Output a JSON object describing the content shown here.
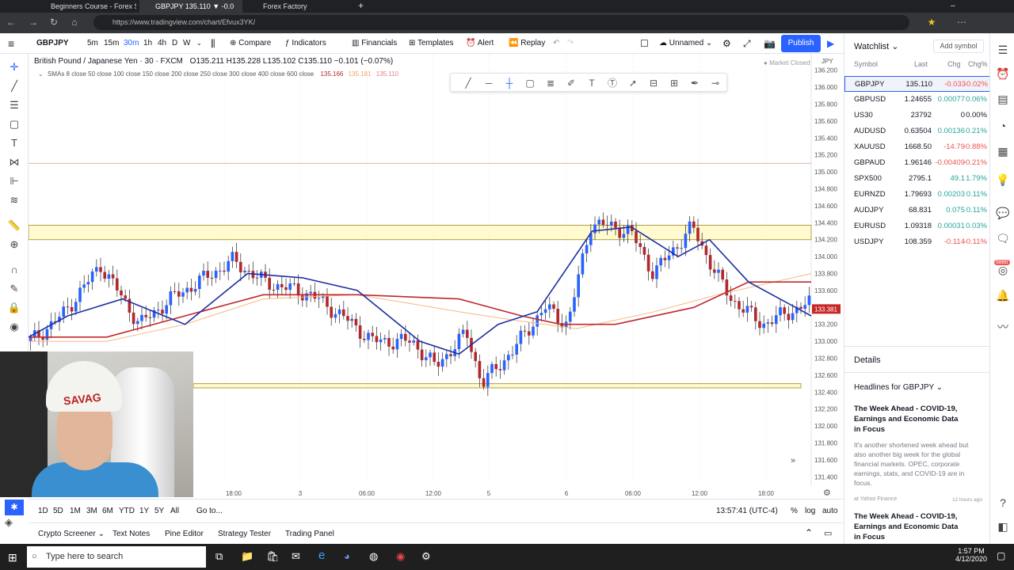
{
  "browser": {
    "tabs": [
      "Beginners Course - Forex Sa",
      "GBPJPY 135.110 ▼ -0.0",
      "Forex Factory"
    ],
    "url": "https://www.tradingview.com/chart/Efvux3YK/"
  },
  "toolbar": {
    "symbol": "GBPJPY",
    "intervals": [
      "5m",
      "15m",
      "30m",
      "1h",
      "4h",
      "D",
      "W"
    ],
    "active_interval": "30m",
    "compare": "Compare",
    "indicators": "Indicators",
    "financials": "Financials",
    "templates": "Templates",
    "alert": "Alert",
    "replay": "Replay",
    "layout_name": "Unnamed",
    "publish": "Publish"
  },
  "legend": {
    "title": "British Pound / Japanese Yen · 30 · FXCM",
    "ohlc": "O135.211  H135.228  L135.102  C135.110  −0.101 (−0.07%)",
    "smas": "SMAs 8 close 50 close 100 close 150 close 200 close 250 close 300 close 400 close 600 close",
    "sma_vals": [
      "135.166",
      "135.181",
      "135.110"
    ],
    "market_status": "Market Closed",
    "currency": "JPY"
  },
  "chart_data": {
    "type": "candlestick",
    "price_axis": [
      "136.200",
      "136.000",
      "135.800",
      "135.600",
      "135.400",
      "135.200",
      "135.000",
      "134.800",
      "134.600",
      "134.400",
      "134.200",
      "134.000",
      "133.800",
      "133.600",
      "133.400",
      "133.200",
      "133.000",
      "132.800",
      "132.600",
      "132.400",
      "132.200",
      "132.000",
      "131.800",
      "131.600",
      "131.400"
    ],
    "ylim": [
      131.3,
      136.3
    ],
    "time_axis": [
      "18:00",
      "3",
      "06:00",
      "12:00",
      "5",
      "6",
      "06:00",
      "12:00",
      "18:00"
    ],
    "current_price": "133.381",
    "zones": [
      [
        134.2,
        134.37
      ],
      [
        132.45,
        132.5
      ]
    ],
    "sma_fast": [
      [
        0,
        133.05
      ],
      [
        0.05,
        133.3
      ],
      [
        0.12,
        133.5
      ],
      [
        0.2,
        133.2
      ],
      [
        0.28,
        133.8
      ],
      [
        0.35,
        133.75
      ],
      [
        0.42,
        133.6
      ],
      [
        0.5,
        133.0
      ],
      [
        0.55,
        132.85
      ],
      [
        0.6,
        133.2
      ],
      [
        0.65,
        133.35
      ],
      [
        0.72,
        134.3
      ],
      [
        0.77,
        134.35
      ],
      [
        0.83,
        134.0
      ],
      [
        0.87,
        134.2
      ],
      [
        0.92,
        133.7
      ],
      [
        1,
        133.3
      ]
    ],
    "sma_mid": [
      [
        0,
        133.05
      ],
      [
        0.1,
        133.05
      ],
      [
        0.2,
        133.3
      ],
      [
        0.3,
        133.55
      ],
      [
        0.42,
        133.55
      ],
      [
        0.55,
        133.5
      ],
      [
        0.63,
        133.3
      ],
      [
        0.68,
        133.2
      ],
      [
        0.75,
        133.2
      ],
      [
        0.85,
        133.4
      ],
      [
        0.92,
        133.7
      ],
      [
        1,
        133.7
      ]
    ],
    "sma_slow": [
      [
        0,
        133.0
      ],
      [
        0.1,
        133.0
      ],
      [
        0.2,
        133.2
      ],
      [
        0.3,
        133.5
      ],
      [
        0.42,
        133.55
      ],
      [
        0.55,
        133.35
      ],
      [
        0.62,
        133.25
      ],
      [
        0.7,
        133.15
      ],
      [
        0.8,
        133.35
      ],
      [
        0.88,
        133.55
      ],
      [
        1,
        133.8
      ]
    ]
  },
  "timeframes": [
    "1D",
    "5D",
    "1M",
    "3M",
    "6M",
    "YTD",
    "1Y",
    "5Y",
    "All"
  ],
  "goto": "Go to...",
  "clock": "13:57:41 (UTC-4)",
  "axis_opts": [
    "%",
    "log",
    "auto"
  ],
  "bottom_tabs": [
    "Crypto Screener",
    "Text Notes",
    "Pine Editor",
    "Strategy Tester",
    "Trading Panel"
  ],
  "watchlist": {
    "title": "Watchlist",
    "add": "Add symbol",
    "headers": [
      "Symbol",
      "Last",
      "Chg",
      "Chg%"
    ],
    "rows": [
      {
        "s": "GBPJPY",
        "l": "135.110",
        "c": "-0.033",
        "p": "-0.02%",
        "dir": "neg"
      },
      {
        "s": "GBPUSD",
        "l": "1.24655",
        "c": "0.00077",
        "p": "0.06%",
        "dir": "pos"
      },
      {
        "s": "US30",
        "l": "23792",
        "c": "0",
        "p": "0.00%",
        "dir": "neu"
      },
      {
        "s": "AUDUSD",
        "l": "0.63504",
        "c": "0.00136",
        "p": "0.21%",
        "dir": "pos"
      },
      {
        "s": "XAUUSD",
        "l": "1668.50",
        "c": "-14.79",
        "p": "-0.88%",
        "dir": "neg"
      },
      {
        "s": "GBPAUD",
        "l": "1.96146",
        "c": "-0.00409",
        "p": "-0.21%",
        "dir": "neg"
      },
      {
        "s": "SPX500",
        "l": "2795.1",
        "c": "49.1",
        "p": "1.79%",
        "dir": "pos"
      },
      {
        "s": "EURNZD",
        "l": "1.79693",
        "c": "0.00203",
        "p": "0.11%",
        "dir": "pos"
      },
      {
        "s": "AUDJPY",
        "l": "68.831",
        "c": "0.075",
        "p": "0.11%",
        "dir": "pos"
      },
      {
        "s": "EURUSD",
        "l": "1.09318",
        "c": "0.00031",
        "p": "0.03%",
        "dir": "pos"
      },
      {
        "s": "USDJPY",
        "l": "108.359",
        "c": "-0.114",
        "p": "-0.11%",
        "dir": "neg"
      }
    ]
  },
  "details": {
    "title": "Details",
    "headlines_title": "Headlines for GBPJPY",
    "news": [
      {
        "headline": "The Week Ahead - COVID-19, Earnings and Economic Data in Focus",
        "body": "It's another shortened week ahead but also another big week for the global financial markets. OPEC, corporate earnings, stats, and COVID-19 are in focus.",
        "source": "at Yahoo Finance",
        "ago": "12 hours ago"
      },
      {
        "headline": "The Week Ahead - COVID-19, Earnings and Economic Data in Focus"
      }
    ]
  },
  "badge": "6880",
  "taskbar": {
    "search": "Type here to search",
    "time": "1:57 PM",
    "date": "4/12/2020"
  },
  "webcam": {
    "hat_text": "SAVAG"
  }
}
